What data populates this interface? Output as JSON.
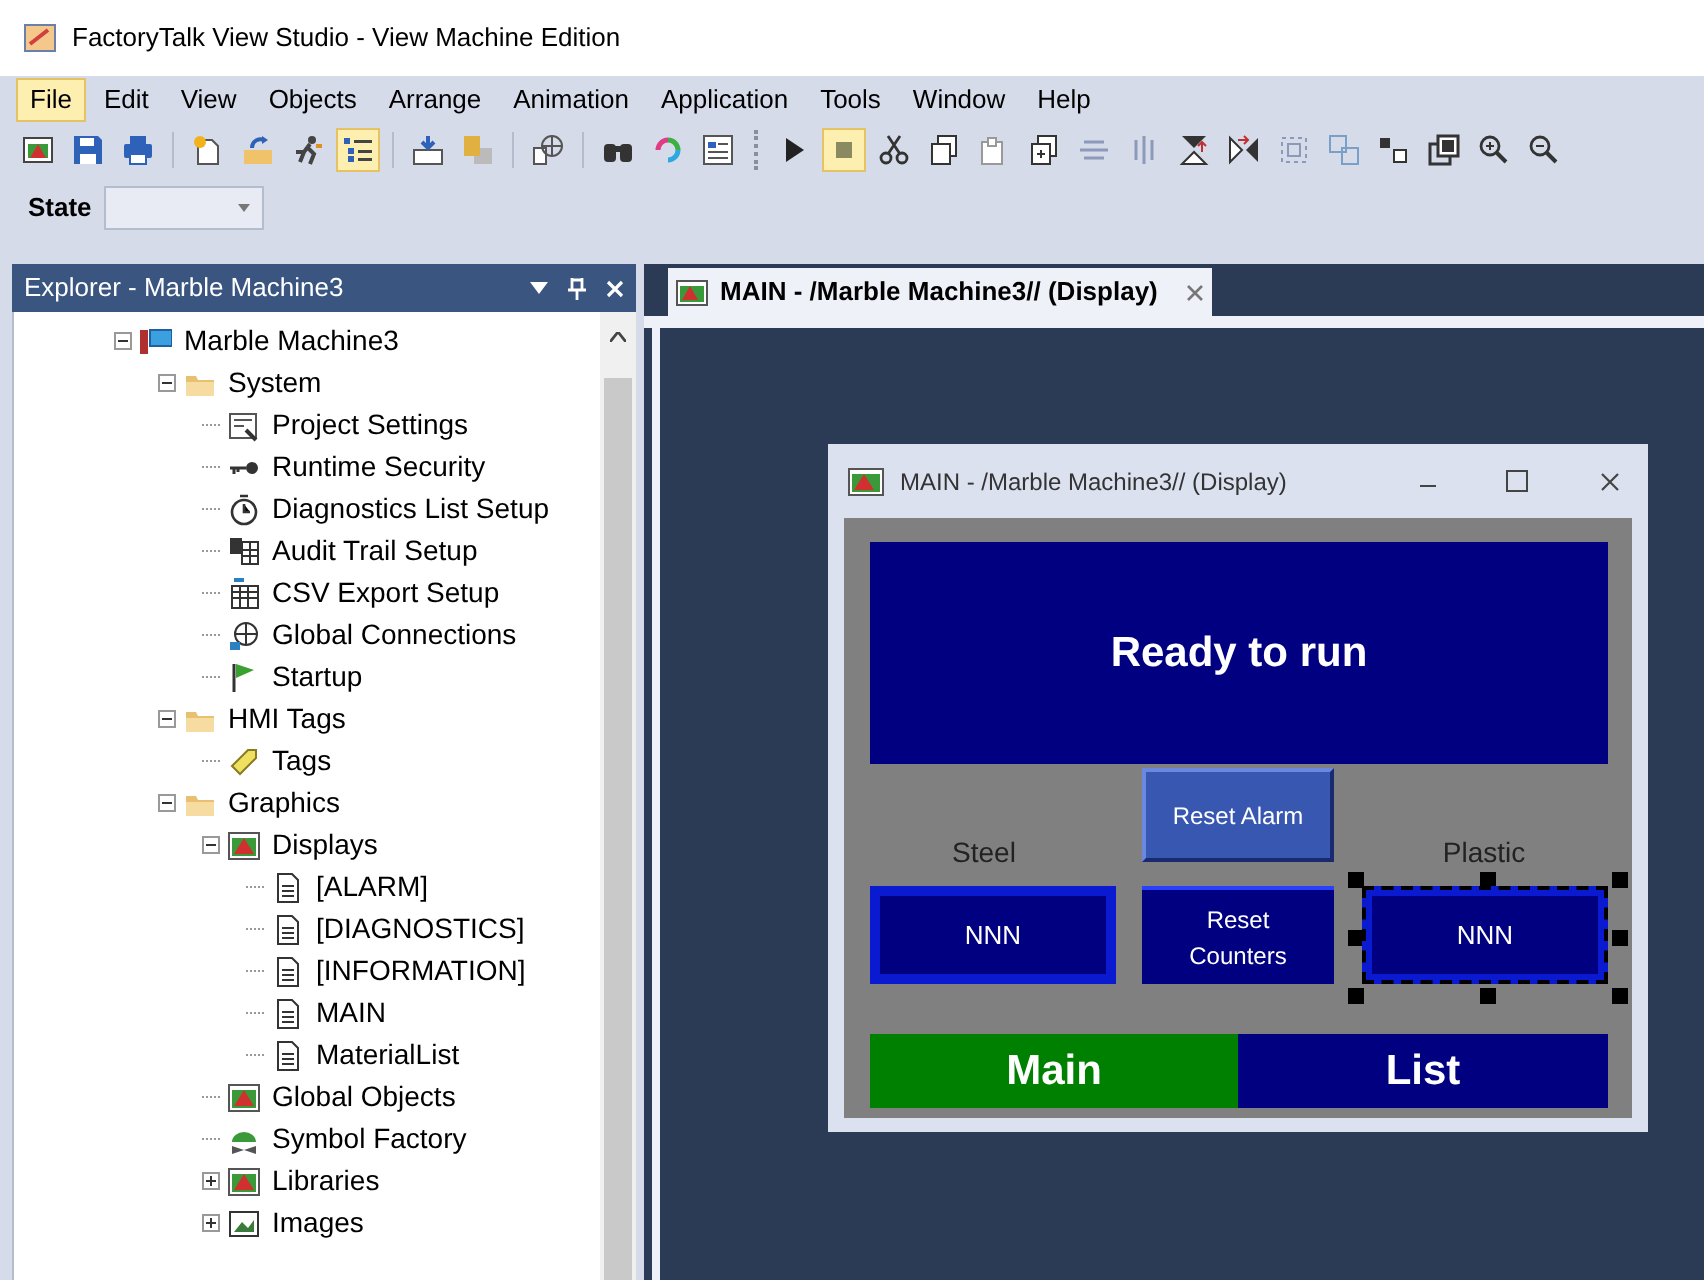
{
  "window": {
    "title": "FactoryTalk View Studio - View Machine Edition"
  },
  "menu": [
    {
      "label": "File",
      "selected": true
    },
    {
      "label": "Edit",
      "selected": false
    },
    {
      "label": "View",
      "selected": false
    },
    {
      "label": "Objects",
      "selected": false
    },
    {
      "label": "Arrange",
      "selected": false
    },
    {
      "label": "Animation",
      "selected": false
    },
    {
      "label": "Application",
      "selected": false
    },
    {
      "label": "Tools",
      "selected": false
    },
    {
      "label": "Window",
      "selected": false
    },
    {
      "label": "Help",
      "selected": false
    }
  ],
  "toolbar": [
    {
      "kind": "display",
      "selected": false
    },
    {
      "kind": "save",
      "selected": false
    },
    {
      "kind": "print",
      "selected": false
    },
    {
      "kind": "sep"
    },
    {
      "kind": "new",
      "selected": false
    },
    {
      "kind": "open",
      "selected": false
    },
    {
      "kind": "runner",
      "selected": false
    },
    {
      "kind": "list",
      "selected": true
    },
    {
      "kind": "sep"
    },
    {
      "kind": "import",
      "selected": false
    },
    {
      "kind": "export",
      "selected": false
    },
    {
      "kind": "sep"
    },
    {
      "kind": "globe",
      "selected": false
    },
    {
      "kind": "sep"
    },
    {
      "kind": "binoculars",
      "selected": false
    },
    {
      "kind": "refresh",
      "selected": false
    },
    {
      "kind": "form",
      "selected": false
    },
    {
      "kind": "grip"
    },
    {
      "kind": "play",
      "selected": false
    },
    {
      "kind": "stop",
      "selected": true
    },
    {
      "kind": "cut",
      "selected": false
    },
    {
      "kind": "copy",
      "selected": false
    },
    {
      "kind": "paste",
      "selected": false
    },
    {
      "kind": "duplicate",
      "selected": false
    },
    {
      "kind": "align-h",
      "selected": false
    },
    {
      "kind": "align-v",
      "selected": false
    },
    {
      "kind": "flip-v",
      "selected": false
    },
    {
      "kind": "flip-h",
      "selected": false
    },
    {
      "kind": "group",
      "selected": false
    },
    {
      "kind": "ungroup",
      "selected": false
    },
    {
      "kind": "arrange",
      "selected": false
    },
    {
      "kind": "front",
      "selected": false
    },
    {
      "kind": "zoom-in",
      "selected": false
    },
    {
      "kind": "zoom-out",
      "selected": false
    }
  ],
  "state_bar": {
    "label": "State"
  },
  "explorer": {
    "title": "Explorer - Marble Machine3",
    "tree": [
      {
        "label": "Marble Machine3",
        "kind": "project",
        "expanded": true,
        "children": [
          {
            "label": "System",
            "kind": "folder",
            "expanded": true,
            "children": [
              {
                "label": "Project Settings",
                "kind": "settings"
              },
              {
                "label": "Runtime Security",
                "kind": "key"
              },
              {
                "label": "Diagnostics List Setup",
                "kind": "clock"
              },
              {
                "label": "Audit Trail Setup",
                "kind": "audit"
              },
              {
                "label": "CSV Export Setup",
                "kind": "csv"
              },
              {
                "label": "Global Connections",
                "kind": "globe"
              },
              {
                "label": "Startup",
                "kind": "flag"
              }
            ]
          },
          {
            "label": "HMI Tags",
            "kind": "folder",
            "expanded": true,
            "children": [
              {
                "label": "Tags",
                "kind": "tag"
              }
            ]
          },
          {
            "label": "Graphics",
            "kind": "folder",
            "expanded": true,
            "children": [
              {
                "label": "Displays",
                "kind": "display",
                "expanded": true,
                "children": [
                  {
                    "label": "[ALARM]",
                    "kind": "doc"
                  },
                  {
                    "label": "[DIAGNOSTICS]",
                    "kind": "doc"
                  },
                  {
                    "label": "[INFORMATION]",
                    "kind": "doc"
                  },
                  {
                    "label": "MAIN",
                    "kind": "doc"
                  },
                  {
                    "label": "MaterialList",
                    "kind": "doc"
                  }
                ]
              },
              {
                "label": "Global Objects",
                "kind": "display"
              },
              {
                "label": "Symbol Factory",
                "kind": "symbol"
              },
              {
                "label": "Libraries",
                "kind": "display",
                "expanded": false
              },
              {
                "label": "Images",
                "kind": "image",
                "expanded": false
              }
            ]
          }
        ]
      }
    ]
  },
  "document_tab": {
    "label": "MAIN - /Marble Machine3// (Display)"
  },
  "display_window": {
    "title": "MAIN - /Marble Machine3// (Display)",
    "objects": [
      {
        "kind": "banner",
        "text": "Ready to run"
      },
      {
        "kind": "raised-button",
        "text": "Reset Alarm"
      },
      {
        "kind": "label",
        "text": "Steel"
      },
      {
        "kind": "numeric",
        "text": "NNN",
        "selected": false
      },
      {
        "kind": "button",
        "text": "Reset Counters"
      },
      {
        "kind": "label",
        "text": "Plastic"
      },
      {
        "kind": "numeric",
        "text": "NNN",
        "selected": true
      },
      {
        "kind": "nav",
        "text": "Main",
        "selected": true
      },
      {
        "kind": "nav",
        "text": "List",
        "selected": false
      }
    ]
  }
}
